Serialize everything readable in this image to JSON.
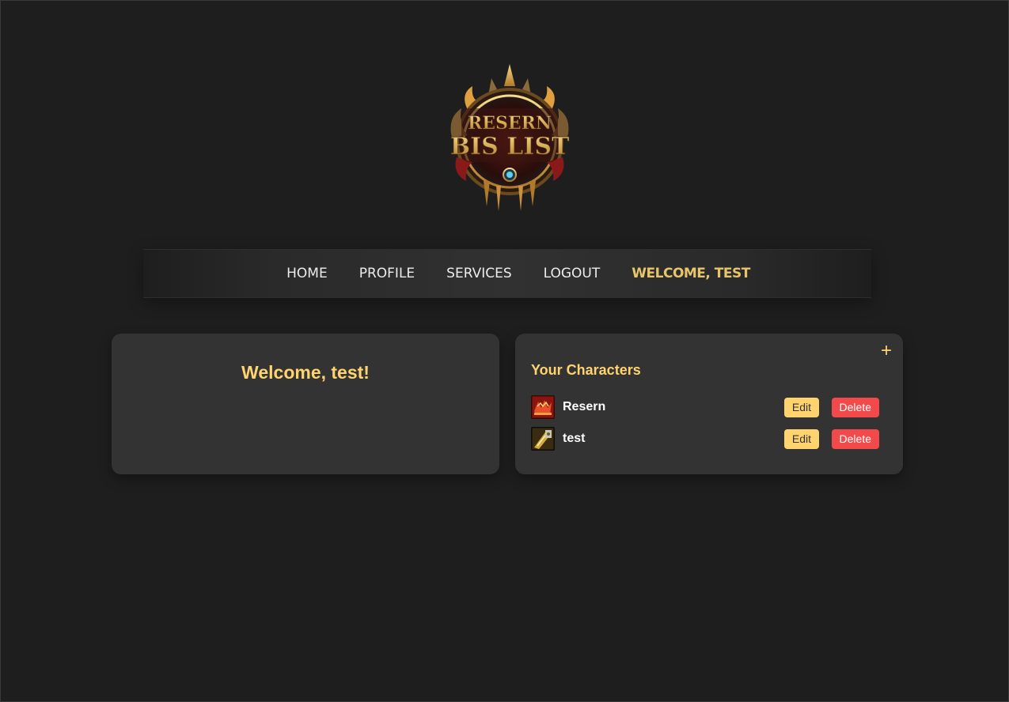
{
  "logo": {
    "line1": "RESERN",
    "line2": "BIS LIST"
  },
  "nav": {
    "links": [
      "HOME",
      "PROFILE",
      "SERVICES",
      "LOGOUT"
    ],
    "welcome": "WELCOME, TEST"
  },
  "welcome_card": {
    "title": "Welcome, test!"
  },
  "characters_card": {
    "title": "Your Characters",
    "add_label": "+",
    "characters": [
      {
        "name": "Resern",
        "icon": "red-class-icon",
        "edit_label": "Edit",
        "delete_label": "Delete"
      },
      {
        "name": "test",
        "icon": "gold-class-icon",
        "edit_label": "Edit",
        "delete_label": "Delete"
      }
    ]
  },
  "colors": {
    "background": "#1e1e1e",
    "card": "#333333",
    "accent": "#ffd36e",
    "danger": "#f24a4a"
  }
}
